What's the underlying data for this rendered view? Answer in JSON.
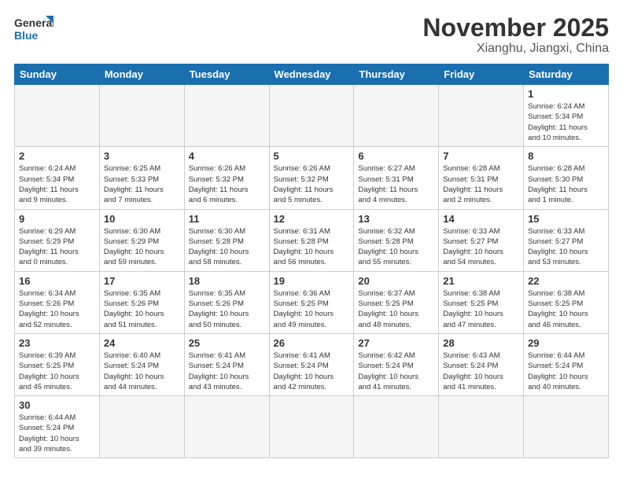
{
  "logo": {
    "line1": "General",
    "line2": "Blue"
  },
  "title": "November 2025",
  "subtitle": "Xianghu, Jiangxi, China",
  "weekdays": [
    "Sunday",
    "Monday",
    "Tuesday",
    "Wednesday",
    "Thursday",
    "Friday",
    "Saturday"
  ],
  "weeks": [
    [
      {
        "day": "",
        "info": ""
      },
      {
        "day": "",
        "info": ""
      },
      {
        "day": "",
        "info": ""
      },
      {
        "day": "",
        "info": ""
      },
      {
        "day": "",
        "info": ""
      },
      {
        "day": "",
        "info": ""
      },
      {
        "day": "1",
        "info": "Sunrise: 6:24 AM\nSunset: 5:34 PM\nDaylight: 11 hours\nand 10 minutes."
      }
    ],
    [
      {
        "day": "2",
        "info": "Sunrise: 6:24 AM\nSunset: 5:34 PM\nDaylight: 11 hours\nand 9 minutes."
      },
      {
        "day": "3",
        "info": "Sunrise: 6:25 AM\nSunset: 5:33 PM\nDaylight: 11 hours\nand 7 minutes."
      },
      {
        "day": "4",
        "info": "Sunrise: 6:26 AM\nSunset: 5:32 PM\nDaylight: 11 hours\nand 6 minutes."
      },
      {
        "day": "5",
        "info": "Sunrise: 6:26 AM\nSunset: 5:32 PM\nDaylight: 11 hours\nand 5 minutes."
      },
      {
        "day": "6",
        "info": "Sunrise: 6:27 AM\nSunset: 5:31 PM\nDaylight: 11 hours\nand 4 minutes."
      },
      {
        "day": "7",
        "info": "Sunrise: 6:28 AM\nSunset: 5:31 PM\nDaylight: 11 hours\nand 2 minutes."
      },
      {
        "day": "8",
        "info": "Sunrise: 6:28 AM\nSunset: 5:30 PM\nDaylight: 11 hours\nand 1 minute."
      }
    ],
    [
      {
        "day": "9",
        "info": "Sunrise: 6:29 AM\nSunset: 5:29 PM\nDaylight: 11 hours\nand 0 minutes."
      },
      {
        "day": "10",
        "info": "Sunrise: 6:30 AM\nSunset: 5:29 PM\nDaylight: 10 hours\nand 59 minutes."
      },
      {
        "day": "11",
        "info": "Sunrise: 6:30 AM\nSunset: 5:28 PM\nDaylight: 10 hours\nand 58 minutes."
      },
      {
        "day": "12",
        "info": "Sunrise: 6:31 AM\nSunset: 5:28 PM\nDaylight: 10 hours\nand 56 minutes."
      },
      {
        "day": "13",
        "info": "Sunrise: 6:32 AM\nSunset: 5:28 PM\nDaylight: 10 hours\nand 55 minutes."
      },
      {
        "day": "14",
        "info": "Sunrise: 6:33 AM\nSunset: 5:27 PM\nDaylight: 10 hours\nand 54 minutes."
      },
      {
        "day": "15",
        "info": "Sunrise: 6:33 AM\nSunset: 5:27 PM\nDaylight: 10 hours\nand 53 minutes."
      }
    ],
    [
      {
        "day": "16",
        "info": "Sunrise: 6:34 AM\nSunset: 5:26 PM\nDaylight: 10 hours\nand 52 minutes."
      },
      {
        "day": "17",
        "info": "Sunrise: 6:35 AM\nSunset: 5:26 PM\nDaylight: 10 hours\nand 51 minutes."
      },
      {
        "day": "18",
        "info": "Sunrise: 6:35 AM\nSunset: 5:26 PM\nDaylight: 10 hours\nand 50 minutes."
      },
      {
        "day": "19",
        "info": "Sunrise: 6:36 AM\nSunset: 5:25 PM\nDaylight: 10 hours\nand 49 minutes."
      },
      {
        "day": "20",
        "info": "Sunrise: 6:37 AM\nSunset: 5:25 PM\nDaylight: 10 hours\nand 48 minutes."
      },
      {
        "day": "21",
        "info": "Sunrise: 6:38 AM\nSunset: 5:25 PM\nDaylight: 10 hours\nand 47 minutes."
      },
      {
        "day": "22",
        "info": "Sunrise: 6:38 AM\nSunset: 5:25 PM\nDaylight: 10 hours\nand 46 minutes."
      }
    ],
    [
      {
        "day": "23",
        "info": "Sunrise: 6:39 AM\nSunset: 5:25 PM\nDaylight: 10 hours\nand 45 minutes."
      },
      {
        "day": "24",
        "info": "Sunrise: 6:40 AM\nSunset: 5:24 PM\nDaylight: 10 hours\nand 44 minutes."
      },
      {
        "day": "25",
        "info": "Sunrise: 6:41 AM\nSunset: 5:24 PM\nDaylight: 10 hours\nand 43 minutes."
      },
      {
        "day": "26",
        "info": "Sunrise: 6:41 AM\nSunset: 5:24 PM\nDaylight: 10 hours\nand 42 minutes."
      },
      {
        "day": "27",
        "info": "Sunrise: 6:42 AM\nSunset: 5:24 PM\nDaylight: 10 hours\nand 41 minutes."
      },
      {
        "day": "28",
        "info": "Sunrise: 6:43 AM\nSunset: 5:24 PM\nDaylight: 10 hours\nand 41 minutes."
      },
      {
        "day": "29",
        "info": "Sunrise: 6:44 AM\nSunset: 5:24 PM\nDaylight: 10 hours\nand 40 minutes."
      }
    ],
    [
      {
        "day": "30",
        "info": "Sunrise: 6:44 AM\nSunset: 5:24 PM\nDaylight: 10 hours\nand 39 minutes."
      },
      {
        "day": "",
        "info": ""
      },
      {
        "day": "",
        "info": ""
      },
      {
        "day": "",
        "info": ""
      },
      {
        "day": "",
        "info": ""
      },
      {
        "day": "",
        "info": ""
      },
      {
        "day": "",
        "info": ""
      }
    ]
  ]
}
